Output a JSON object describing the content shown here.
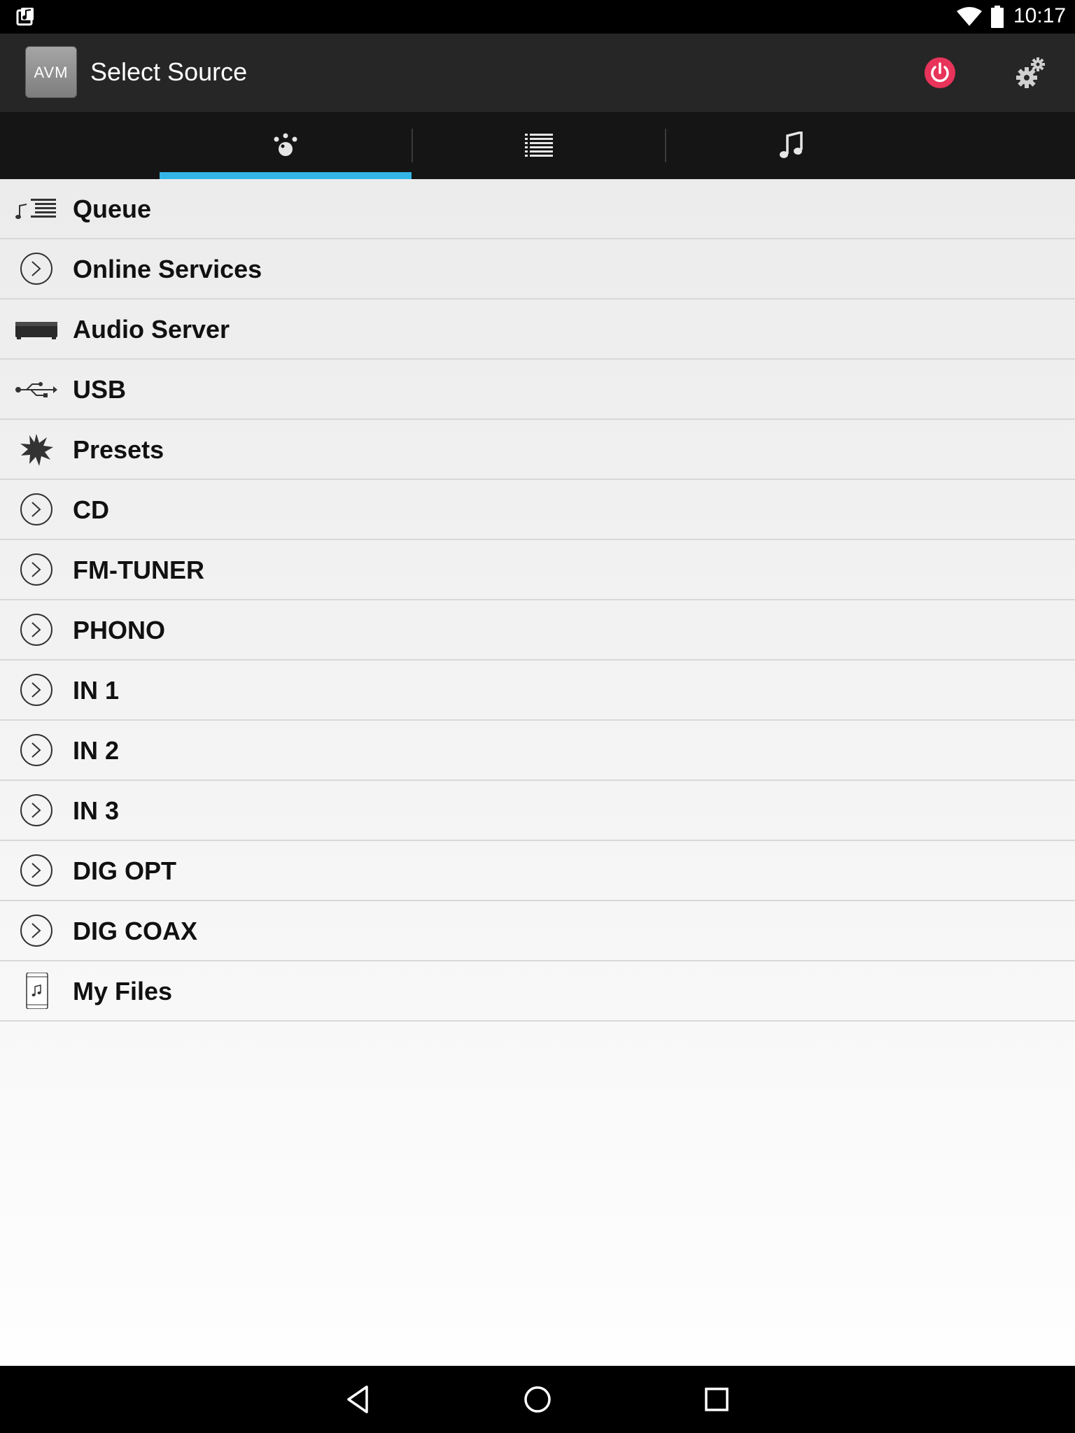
{
  "status_bar": {
    "time": "10:17"
  },
  "app_bar": {
    "logo_text": "AVM",
    "title": "Select Source"
  },
  "tabs": [
    {
      "name": "sources-tab",
      "icon": "source-dial-icon",
      "selected": true
    },
    {
      "name": "list-tab",
      "icon": "list-icon",
      "selected": false
    },
    {
      "name": "now-playing-tab",
      "icon": "music-note-icon",
      "selected": false
    }
  ],
  "sources": [
    {
      "label": "Queue",
      "icon": "queue-icon"
    },
    {
      "label": "Online Services",
      "icon": "chevron-circle-icon"
    },
    {
      "label": "Audio Server",
      "icon": "server-device-icon"
    },
    {
      "label": "USB",
      "icon": "usb-icon"
    },
    {
      "label": "Presets",
      "icon": "star-burst-icon"
    },
    {
      "label": "CD",
      "icon": "chevron-circle-icon"
    },
    {
      "label": "FM-TUNER",
      "icon": "chevron-circle-icon"
    },
    {
      "label": "PHONO",
      "icon": "chevron-circle-icon"
    },
    {
      "label": "IN 1",
      "icon": "chevron-circle-icon"
    },
    {
      "label": "IN 2",
      "icon": "chevron-circle-icon"
    },
    {
      "label": "IN 3",
      "icon": "chevron-circle-icon"
    },
    {
      "label": "DIG OPT",
      "icon": "chevron-circle-icon"
    },
    {
      "label": "DIG COAX",
      "icon": "chevron-circle-icon"
    },
    {
      "label": "My Files",
      "icon": "phone-music-icon"
    }
  ],
  "colors": {
    "accent": "#33b5e5",
    "power": "#e8335a"
  }
}
